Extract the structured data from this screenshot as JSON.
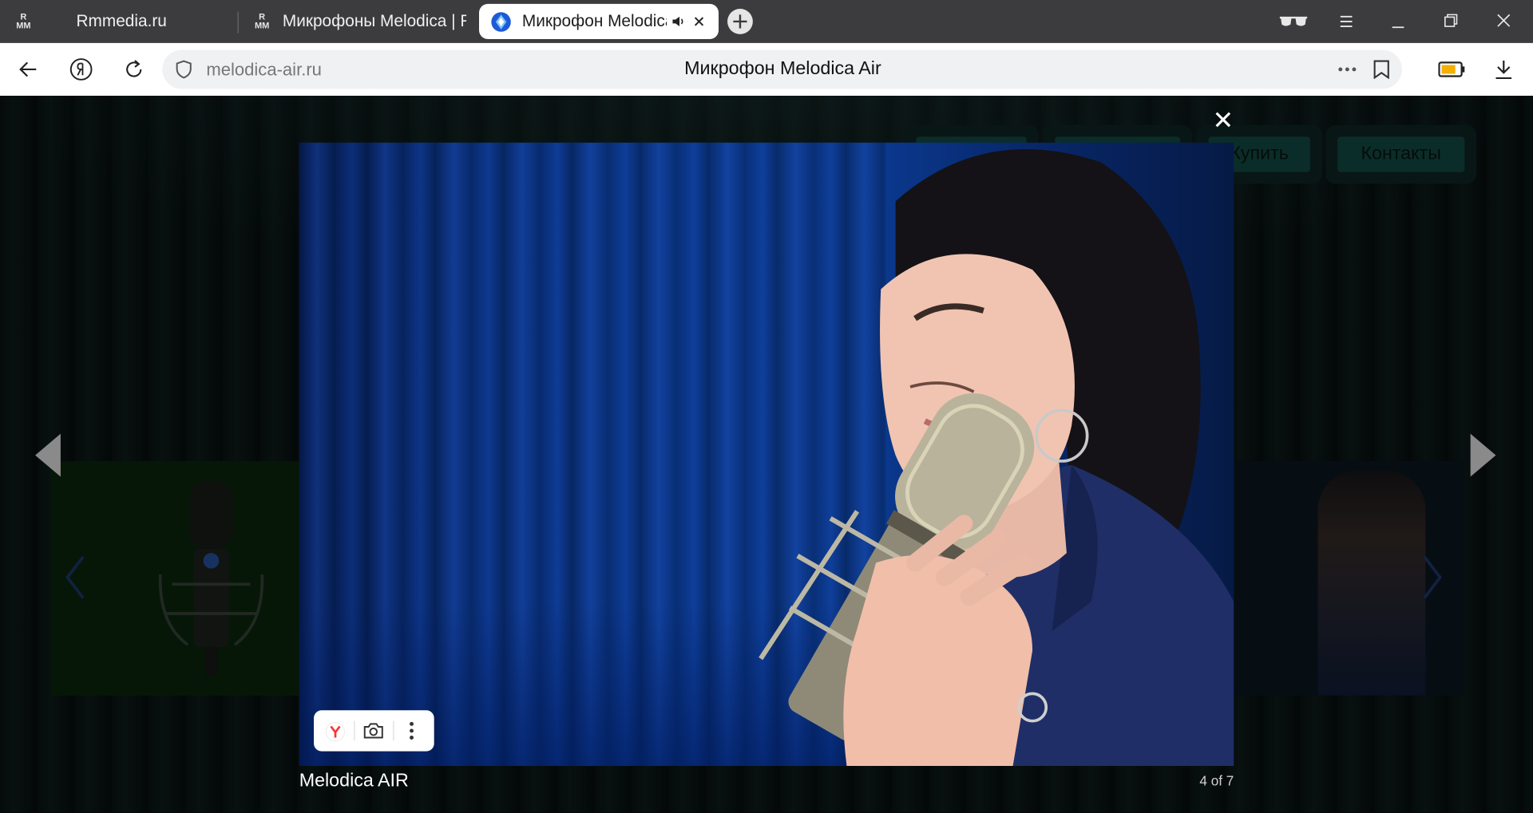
{
  "browser": {
    "tabs": [
      {
        "title": "Rmmedia.ru",
        "favicon": "rmm-logo-icon"
      },
      {
        "title": "Микрофоны Melodica | Rm",
        "favicon": "rmm-logo-icon"
      },
      {
        "title": "Микрофон Melodica",
        "favicon": "melodica-favicon-icon",
        "active": true,
        "audio": true
      }
    ],
    "logo_text": {
      "r": "R",
      "mm": "MM"
    },
    "address": {
      "url": "melodica-air.ru",
      "page_title": "Микрофон Melodica Air"
    }
  },
  "site": {
    "nav_buttons": [
      "Купить",
      "Контакты"
    ]
  },
  "lightbox": {
    "caption": "Melodica AIR",
    "counter": "4 of 7",
    "close_symbol": "✕"
  },
  "colors": {
    "tab_strip": "#3c3c3e",
    "page_background": "#0b1413",
    "site_button": "#14524b",
    "curtain_blue": "#0a3a92"
  }
}
